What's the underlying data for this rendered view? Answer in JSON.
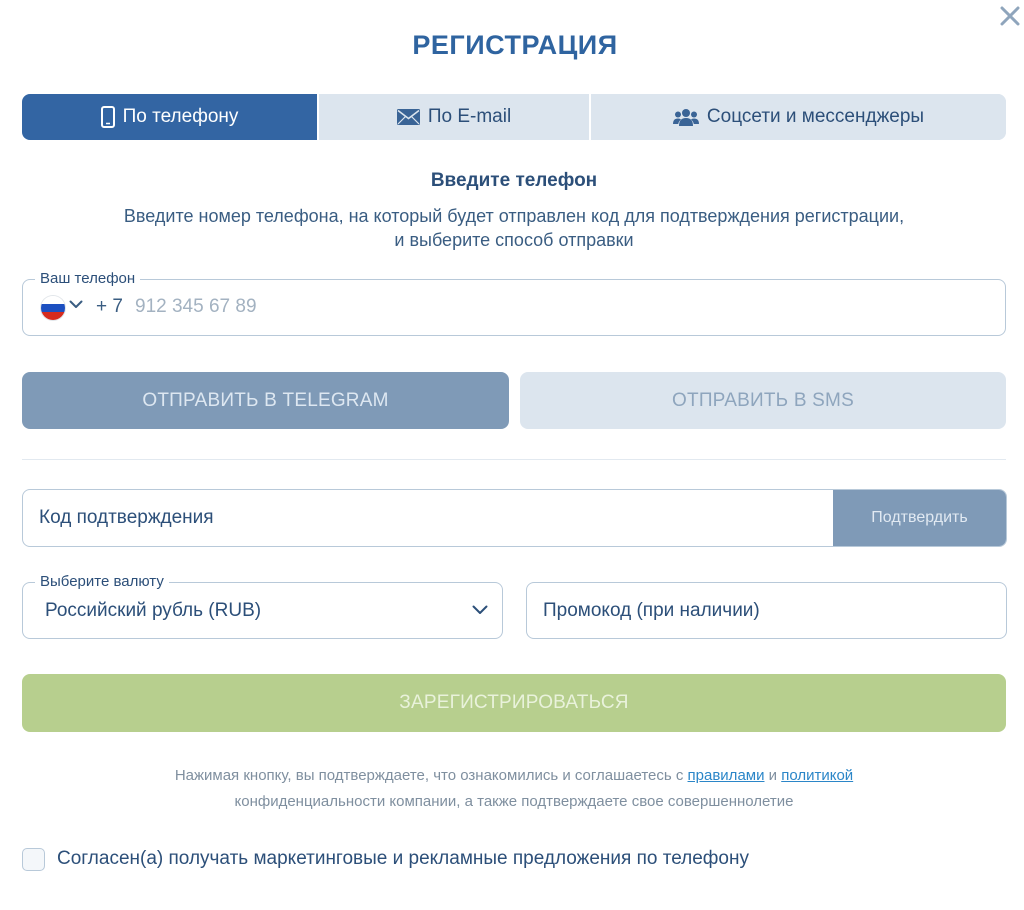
{
  "dialog": {
    "title": "РЕГИСТРАЦИЯ",
    "close_icon": "close-icon"
  },
  "tabs": [
    {
      "label": "По телефону",
      "icon": "phone-icon",
      "active": true
    },
    {
      "label": "По E-mail",
      "icon": "envelope-icon",
      "active": false
    },
    {
      "label": "Соцсети и мессенджеры",
      "icon": "users-icon",
      "active": false
    }
  ],
  "phone_section": {
    "heading": "Введите телефон",
    "description_line1": "Введите номер телефона, на который будет отправлен код для подтверждения регистрации,",
    "description_line2": "и выберите способ отправки",
    "field_label": "Ваш телефон",
    "country_icon": "russia-flag-icon",
    "country_code": "+ 7",
    "placeholder": "912 345 67 89",
    "value": ""
  },
  "send_buttons": {
    "telegram": "ОТПРАВИТЬ В TELEGRAM",
    "sms": "ОТПРАВИТЬ В SMS"
  },
  "confirmation": {
    "placeholder": "Код подтверждения",
    "button": "Подтвердить"
  },
  "currency": {
    "label": "Выберите валюту",
    "selected": "Российский рубль (RUB)"
  },
  "promo": {
    "placeholder": "Промокод (при наличии)"
  },
  "register_button": "ЗАРЕГИСТРИРОВАТЬСЯ",
  "legal": {
    "text_before": "Нажимая кнопку, вы подтверждаете, что ознакомились и соглашаетесь с ",
    "rules_link": "правилами",
    "and": " и ",
    "policy_link": "политикой",
    "text_after": "конфиденциальности компании, а также подтверждаете свое совершеннолетие"
  },
  "marketing": {
    "checked": false,
    "label": "Согласен(а) получать маркетинговые и рекламные предложения по телефону"
  },
  "colors": {
    "primary": "#3365a3",
    "title": "#2f64a0",
    "tab_inactive": "#dce5ee",
    "disabled_button": "#7f9ab7",
    "register": "#b7cf8e",
    "link": "#2b86c8"
  }
}
